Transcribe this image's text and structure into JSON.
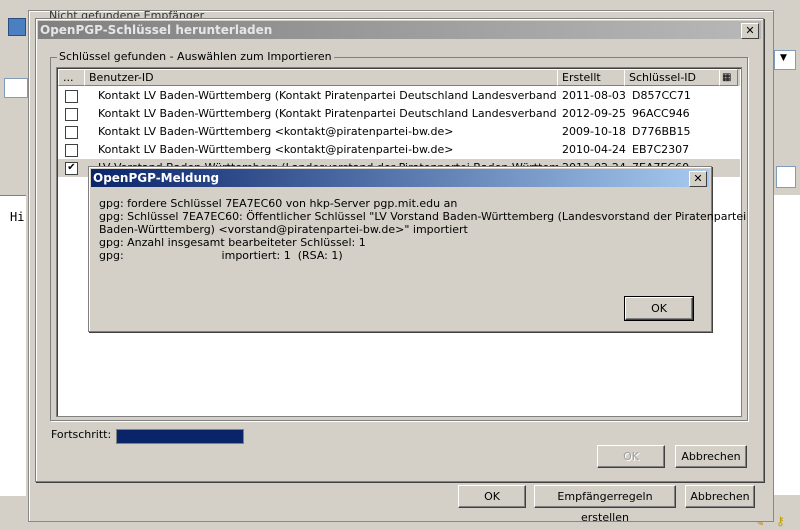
{
  "background": {
    "partial_title": "Nicht gefundene Empfänger",
    "editor_text": "Hi"
  },
  "download_dialog": {
    "title": "OpenPGP-Schlüssel herunterladen",
    "group_label": "Schlüssel gefunden - Auswählen zum Importieren",
    "columns": {
      "select": "...",
      "user_id": "Benutzer-ID",
      "created": "Erstellt",
      "key_id": "Schlüssel-ID"
    },
    "rows": [
      {
        "checked": false,
        "user_id": "Kontakt LV Baden-Württemberg (Kontakt Piratenpartei Deutschland Landesverband Baden-W...",
        "created": "2011-08-03",
        "key_id": "D857CC71"
      },
      {
        "checked": false,
        "user_id": "Kontakt LV Baden-Württemberg (Kontakt Piratenpartei Deutschland Landesverband Baden-W...",
        "created": "2012-09-25",
        "key_id": "96ACC946"
      },
      {
        "checked": false,
        "user_id": "Kontakt LV Baden-Württemberg <kontakt@piratenpartei-bw.de>",
        "created": "2009-10-18",
        "key_id": "D776BB15"
      },
      {
        "checked": false,
        "user_id": "Kontakt LV Baden-Württemberg <kontakt@piratenpartei-bw.de>",
        "created": "2010-04-24",
        "key_id": "EB7C2307"
      },
      {
        "checked": true,
        "user_id": "LV Vorstand Baden-Württemberg (Landesvorstand der Piratenpartei Baden-Württemberg) <v...",
        "created": "2012-02-24",
        "key_id": "7EA7EC60"
      }
    ],
    "progress_label": "Fortschritt:",
    "progress_fraction": 1.0,
    "ok_label": "OK",
    "cancel_label": "Abbrechen"
  },
  "main_window": {
    "ok_label": "OK",
    "rules_label": "Empfängerregeln erstellen",
    "cancel_label": "Abbrechen"
  },
  "message_dialog": {
    "title": "OpenPGP-Meldung",
    "lines": [
      "gpg: fordere Schlüssel 7EA7EC60 von hkp-Server pgp.mit.edu an",
      "gpg: Schlüssel 7EA7EC60: Öffentlicher Schlüssel \"LV Vorstand Baden-Württemberg (Landesvorstand der Piratenpartei",
      "Baden-Württemberg) <vorstand@piratenpartei-bw.de>\" importiert",
      "gpg: Anzahl insgesamt bearbeiteter Schlüssel: 1",
      "gpg:                            importiert: 1  (RSA: 1)"
    ],
    "ok_label": "OK"
  }
}
